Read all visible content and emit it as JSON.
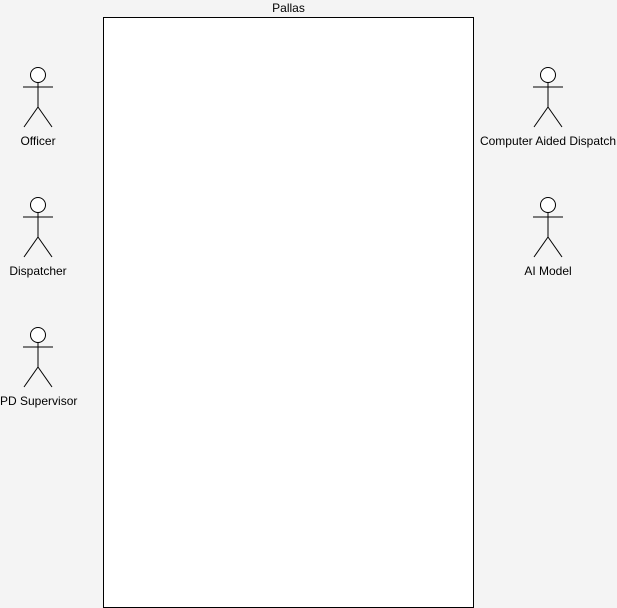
{
  "system": {
    "title": "Pallas"
  },
  "actors": {
    "officer": "Officer",
    "dispatcher": "Dispatcher",
    "pd_supervisor": "PD Supervisor",
    "cad": "Computer Aided Dispatch",
    "ai_model": "AI Model"
  }
}
